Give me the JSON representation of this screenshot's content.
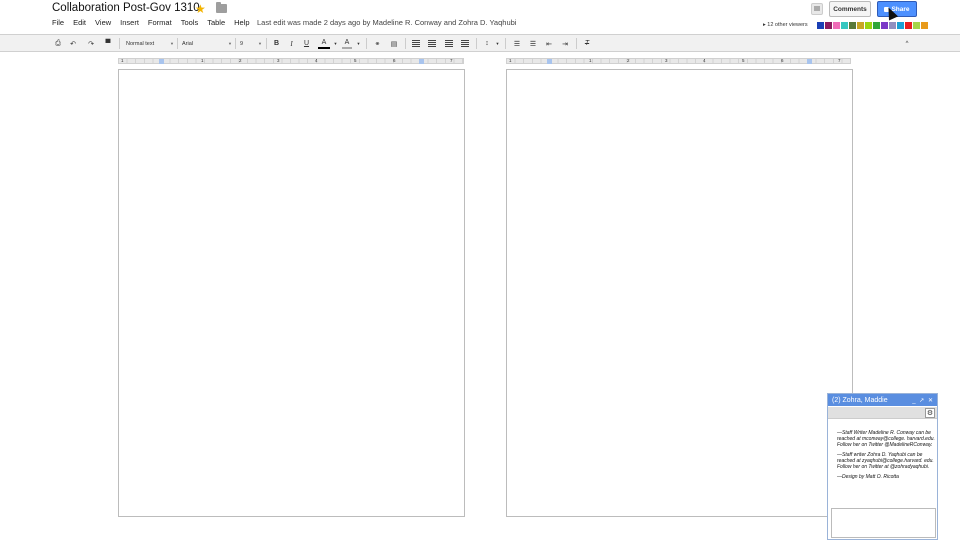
{
  "header": {
    "title": "Collaboration Post-Gov 1310",
    "star_icon": "star-icon",
    "folder_icon": "folder-icon",
    "menus": [
      "File",
      "Edit",
      "View",
      "Insert",
      "Format",
      "Tools",
      "Table",
      "Help"
    ],
    "last_edit": "Last edit was made 2 days ago by Madeline R. Conway and Zohra D. Yaqhubi",
    "comments_label": "Comments",
    "share_label": "Share",
    "viewers_label": "▸ 12 other viewers",
    "viewer_colors": [
      "#1a3fb5",
      "#8b1a5e",
      "#f06cb8",
      "#36c7c0",
      "#5a7a3a",
      "#c9a623",
      "#9bd40f",
      "#2fa63a",
      "#7a39c7",
      "#9090c0",
      "#1aa0d4",
      "#e81f1f",
      "#a5d64a",
      "#e89a1a"
    ],
    "accent": "#4d90fe"
  },
  "toolbar": {
    "style": "Normal text",
    "font": "Arial",
    "size": "9",
    "bold": "B",
    "italic": "I",
    "underline": "U",
    "text_color": "A",
    "highlight": "A",
    "collapse": "^"
  },
  "ruler": {
    "left_numbers": [
      "1",
      "1",
      "2",
      "3",
      "4",
      "5",
      "6",
      "7"
    ],
    "right_numbers": [
      "1",
      "1",
      "2",
      "3",
      "4",
      "5",
      "6",
      "7"
    ]
  },
  "chat": {
    "title": "(2) Zohra, Maddie",
    "controls": "_ ↗ ✕",
    "messages": [
      "—Staff Writer Madeline R. Conway can be reached at mconway@college. harvard.edu. Follow her on Twitter @MadelineRConway.",
      "—Staff writer Zohra D. Yaqhubi can be reached at zyaqhubi@college.harvard. edu. Follow her on Twitter at @zohradyaqhubi.",
      "—Design by Matt O. Ricotta"
    ]
  }
}
